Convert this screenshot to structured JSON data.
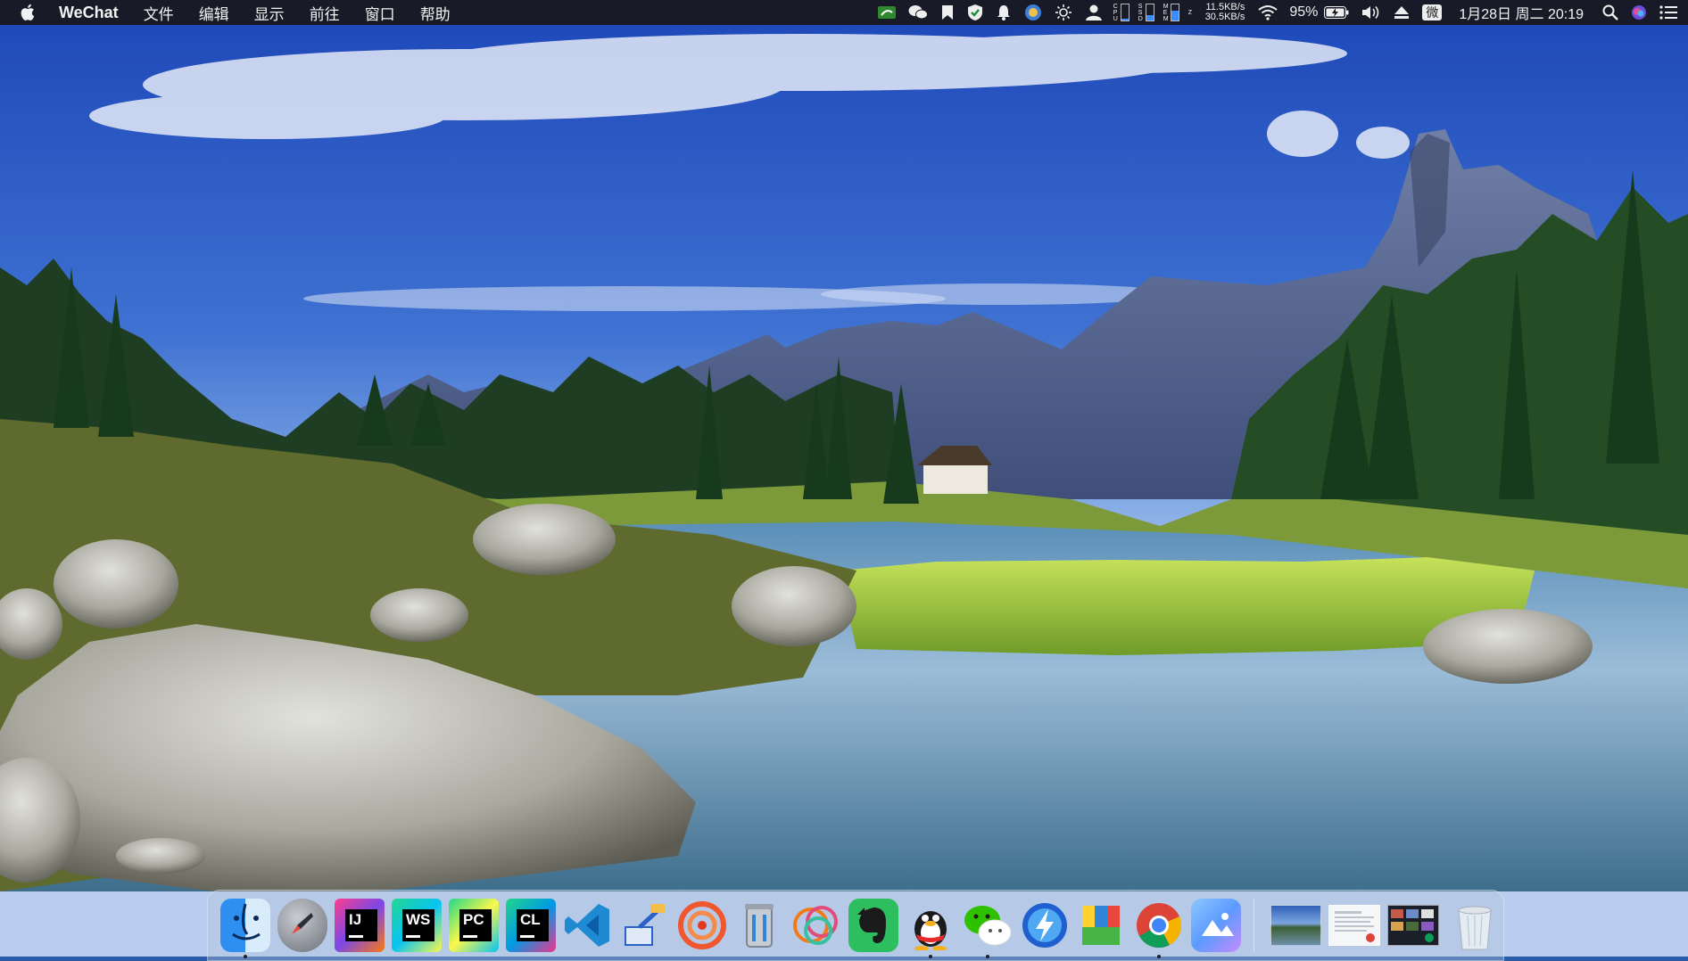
{
  "menubar": {
    "apple_icon": "apple-logo-icon",
    "app_name": "WeChat",
    "menus": [
      "文件",
      "编辑",
      "显示",
      "前往",
      "窗口",
      "帮助"
    ],
    "status_icons": [
      "nvidia-icon",
      "wechat-icon",
      "bookmark-icon",
      "shield-icon",
      "bell-icon",
      "vpn-icon",
      "brightness-icon",
      "user-icon"
    ],
    "meters": [
      {
        "label": "CPU",
        "level": 0.1
      },
      {
        "label": "SSD",
        "level": 0.35
      },
      {
        "label": "MEM",
        "level": 0.6
      },
      {
        "label": "Z",
        "level": 0
      }
    ],
    "net_up": "11.5KB/s",
    "net_down": "30.5KB/s",
    "battery_percent": "95%",
    "input_method": "微",
    "datetime": "1月28日 周二 20:19"
  },
  "dock": {
    "apps": [
      {
        "name": "Finder",
        "icon": "finder-icon",
        "running": true
      },
      {
        "name": "Launchpad",
        "icon": "launchpad-rocket-icon",
        "running": false
      },
      {
        "name": "IntelliJ IDEA",
        "icon": "intellij-icon",
        "text": "IJ",
        "running": false
      },
      {
        "name": "WebStorm",
        "icon": "webstorm-icon",
        "text": "WS",
        "running": false
      },
      {
        "name": "PyCharm",
        "icon": "pycharm-icon",
        "text": "PC",
        "running": false
      },
      {
        "name": "CLion",
        "icon": "clion-icon",
        "text": "CL",
        "running": false
      },
      {
        "name": "Visual Studio Code",
        "icon": "vscode-icon",
        "running": false
      },
      {
        "name": "Remote Desktop",
        "icon": "remote-desktop-icon",
        "running": false
      },
      {
        "name": "Swift",
        "icon": "swift-icon",
        "running": false
      },
      {
        "name": "Cleaner",
        "icon": "cleaner-bin-icon",
        "running": false
      },
      {
        "name": "Paw",
        "icon": "rings-icon",
        "running": false
      },
      {
        "name": "Evernote",
        "icon": "evernote-icon",
        "running": false
      },
      {
        "name": "QQ",
        "icon": "qq-penguin-icon",
        "running": true
      },
      {
        "name": "WeChat",
        "icon": "wechat-icon",
        "running": true
      },
      {
        "name": "Thunder",
        "icon": "thunder-icon",
        "running": false
      },
      {
        "name": "Maps",
        "icon": "maps-icon",
        "running": false
      },
      {
        "name": "Chrome",
        "icon": "chrome-icon",
        "running": true
      },
      {
        "name": "Photos",
        "icon": "photos-cloud-icon",
        "running": false
      }
    ],
    "recents": [
      "desktop-thumbnail",
      "document-thumbnail",
      "photo-grid-thumbnail"
    ],
    "trash": {
      "name": "Trash",
      "icon": "trash-icon"
    }
  }
}
